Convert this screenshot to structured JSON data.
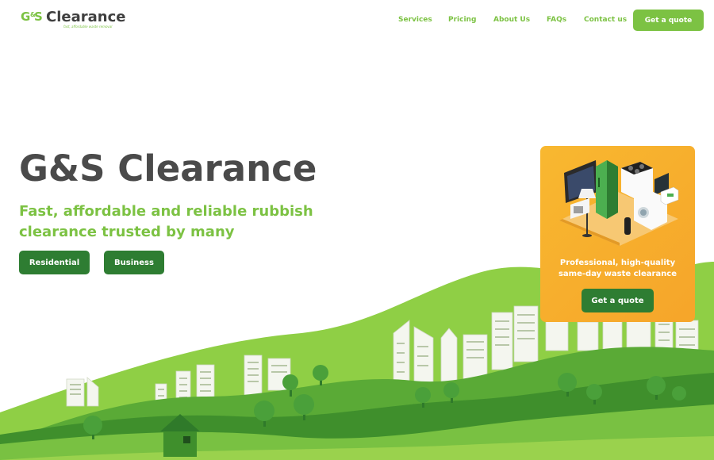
{
  "brand": {
    "mark_left": "G",
    "mark_amp": "&",
    "mark_right": "S",
    "name": "Clearance",
    "tagline": "fast, affordable waste removal"
  },
  "nav": {
    "items": [
      "Services",
      "Pricing",
      "About Us",
      "FAQs",
      "Contact us"
    ],
    "cta": "Get a quote"
  },
  "hero": {
    "title": "G&S Clearance",
    "subtitle": "Fast, affordable and reliable rubbish clearance trusted by many",
    "buttons": [
      "Residential",
      "Business"
    ]
  },
  "promo": {
    "text_line1": "Professional, high-quality",
    "text_line2": "same-day waste clearance",
    "button": "Get a quote"
  },
  "colors": {
    "brand_green": "#7cc243",
    "dark_green": "#2e7d32",
    "title_grey": "#4a4a4a",
    "promo_orange": "#f6ae2d"
  },
  "icons": {
    "hero_art": "green-hills-city-illustration",
    "promo_art": "household-appliances-illustration"
  }
}
